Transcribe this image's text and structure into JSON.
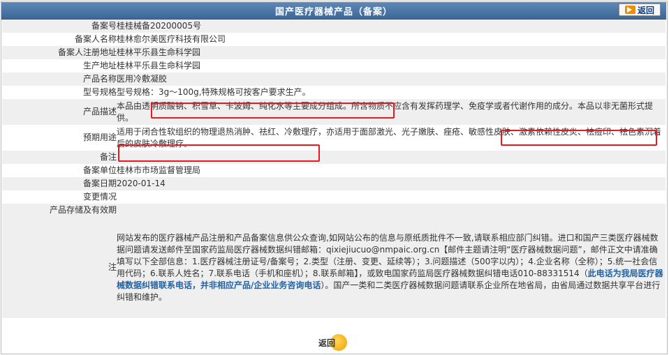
{
  "header": {
    "title": "国产医疗器械产品（备案）",
    "back_label": "返回"
  },
  "rows": [
    {
      "label": "备案号",
      "value": "桂桂械备20200005号"
    },
    {
      "label": "备案人名称",
      "value": "桂林愈尔美医疗科技有限公司"
    },
    {
      "label": "备案人注册地址",
      "value": "桂林平乐县生命科学园"
    },
    {
      "label": "生产地址",
      "value": "桂林平乐县生命科学园"
    },
    {
      "label": "产品名称",
      "value": "医用冷敷凝胶"
    },
    {
      "label": "型号规格",
      "value": "型号规格：3g～100g,特殊规格可按客户要求生产。"
    },
    {
      "label": "产品描述",
      "value": "本品由透明质酸钠、积雪草、卡波姆、纯化水等主要成分组成。所含物质不应含有发挥药理学、免疫学或者代谢作用的成分。本品以非无菌形式提供。"
    },
    {
      "label": "预期用途",
      "value": "适用于闭合性软组织的物理退热消肿、祛红、冷敷理疗，亦适用于面部激光、光子嫩肤、痤疮、敏感性皮肤、激素依赖性皮炎、祛痘印、祛色素沉着后的皮肤冷敷理疗。"
    },
    {
      "label": "备注",
      "value": ""
    },
    {
      "label": "备案单位",
      "value": "桂林市市场监督管理局"
    },
    {
      "label": "备案日期",
      "value": "2020-01-14"
    },
    {
      "label": "变更情况",
      "value": ""
    },
    {
      "label": "产品存储及有效期",
      "value": ""
    }
  ],
  "note": {
    "label": "注",
    "p1": "网站发布的医疗器械产品注册和产品备案信息供公众查询,如网站公布的信息与原纸质批件不一致,请联系相应部门纠错。进口和国产三类医疗器械数据问题请发送邮件至国家药监局医疗器械数据纠错邮箱：qixiejiucuo@nmpaic.org.cn【邮件主题请注明“医疗器械数据问题”，邮件正文中请准确填写以下全部信息：1.医疗器械注册证号/备案号；2.类型（注册、变更、延续等）；3.问题描述（500字以内）；4.企业名称（全称）；5.统一社会信用代码；6.联系人姓名；7.联系电话（手机和座机）；8.联系邮箱】，或致电国家药监局医疗器械数据纠错电话010-88331514（",
    "bold": "此电话为我局医疗器械数据纠错联系电话，并非相应产品/企业业务咨询电话",
    "p2": "）。国产一类和二类医疗器械数据问题请联系企业所在地省局，由省局通过数据共享平台进行纠错和维护。"
  },
  "footer": {
    "back_label": "返回"
  },
  "colors": {
    "title_bg": "#4a76a8",
    "highlight": "#e8191e",
    "note_text": "#1f62a8",
    "row_alt": "#efefef"
  }
}
